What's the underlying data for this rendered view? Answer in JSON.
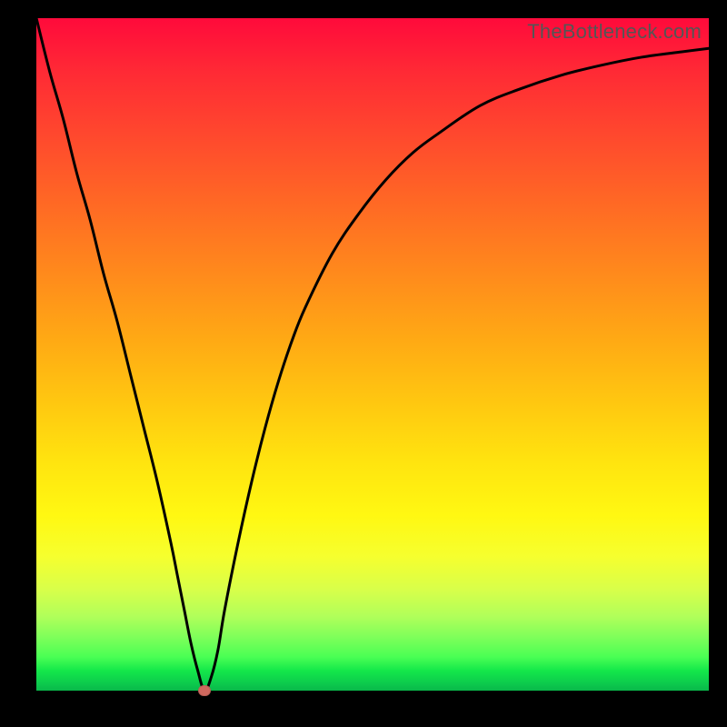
{
  "watermark": "TheBottleneck.com",
  "colors": {
    "curve": "#000000",
    "marker": "#cf685e",
    "frame": "#000000"
  },
  "chart_data": {
    "type": "line",
    "title": "",
    "xlabel": "",
    "ylabel": "",
    "xlim": [
      0,
      100
    ],
    "ylim": [
      0,
      100
    ],
    "grid": false,
    "legend": false,
    "series": [
      {
        "name": "bottleneck-curve",
        "x": [
          0,
          2,
          4,
          6,
          8,
          10,
          12,
          14,
          16,
          18,
          20,
          21,
          22,
          23,
          24,
          25,
          26,
          27,
          28,
          30,
          32,
          34,
          36,
          38,
          40,
          44,
          48,
          52,
          56,
          60,
          66,
          72,
          78,
          84,
          90,
          96,
          100
        ],
        "values": [
          100,
          92,
          85,
          77,
          70,
          62,
          55,
          47,
          39,
          31,
          22,
          17,
          12,
          7,
          3,
          0,
          2,
          6,
          12,
          22,
          31,
          39,
          46,
          52,
          57,
          65,
          71,
          76,
          80,
          83,
          87,
          89.5,
          91.5,
          93,
          94.2,
          95,
          95.5
        ]
      }
    ],
    "marker": {
      "name": "minimum-point",
      "x": 25,
      "y": 0
    },
    "description": "V-shaped bottleneck curve on rainbow background; minimum at x≈25 where curve touches y=0, steep linear descent on left, asymptotic rise toward ~95 on right."
  }
}
